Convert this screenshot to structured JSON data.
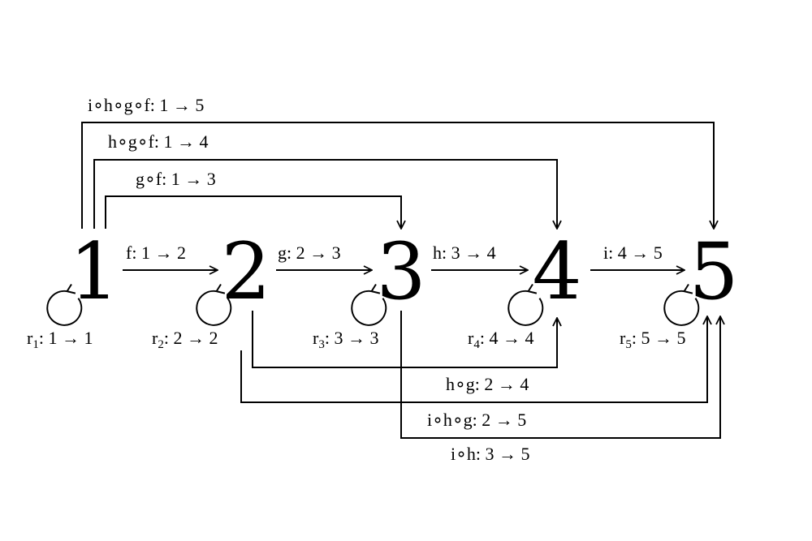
{
  "objects": [
    {
      "id": "1",
      "label": "1"
    },
    {
      "id": "2",
      "label": "2"
    },
    {
      "id": "3",
      "label": "3"
    },
    {
      "id": "4",
      "label": "4"
    },
    {
      "id": "5",
      "label": "5"
    }
  ],
  "identities": [
    {
      "name": "r",
      "sub": "1",
      "rest": ": 1 → 1"
    },
    {
      "name": "r",
      "sub": "2",
      "rest": ": 2 → 2"
    },
    {
      "name": "r",
      "sub": "3",
      "rest": ": 3 → 3"
    },
    {
      "name": "r",
      "sub": "4",
      "rest": ": 4 → 4"
    },
    {
      "name": "r",
      "sub": "5",
      "rest": ": 5 → 5"
    }
  ],
  "morphisms": [
    {
      "label": "f: 1 → 2"
    },
    {
      "label": "g: 2 → 3"
    },
    {
      "label": "h: 3 → 4"
    },
    {
      "label": "i: 4 → 5"
    }
  ],
  "compositions_top": [
    {
      "label": "i∘h∘g∘f: 1 → 5"
    },
    {
      "label": "h∘g∘f: 1 → 4"
    },
    {
      "label": "g∘f: 1 → 3"
    }
  ],
  "compositions_bottom": [
    {
      "label": "h∘g: 2 → 4"
    },
    {
      "label": "i∘h∘g: 2 → 5"
    },
    {
      "label": "i∘h: 3 → 5"
    }
  ]
}
